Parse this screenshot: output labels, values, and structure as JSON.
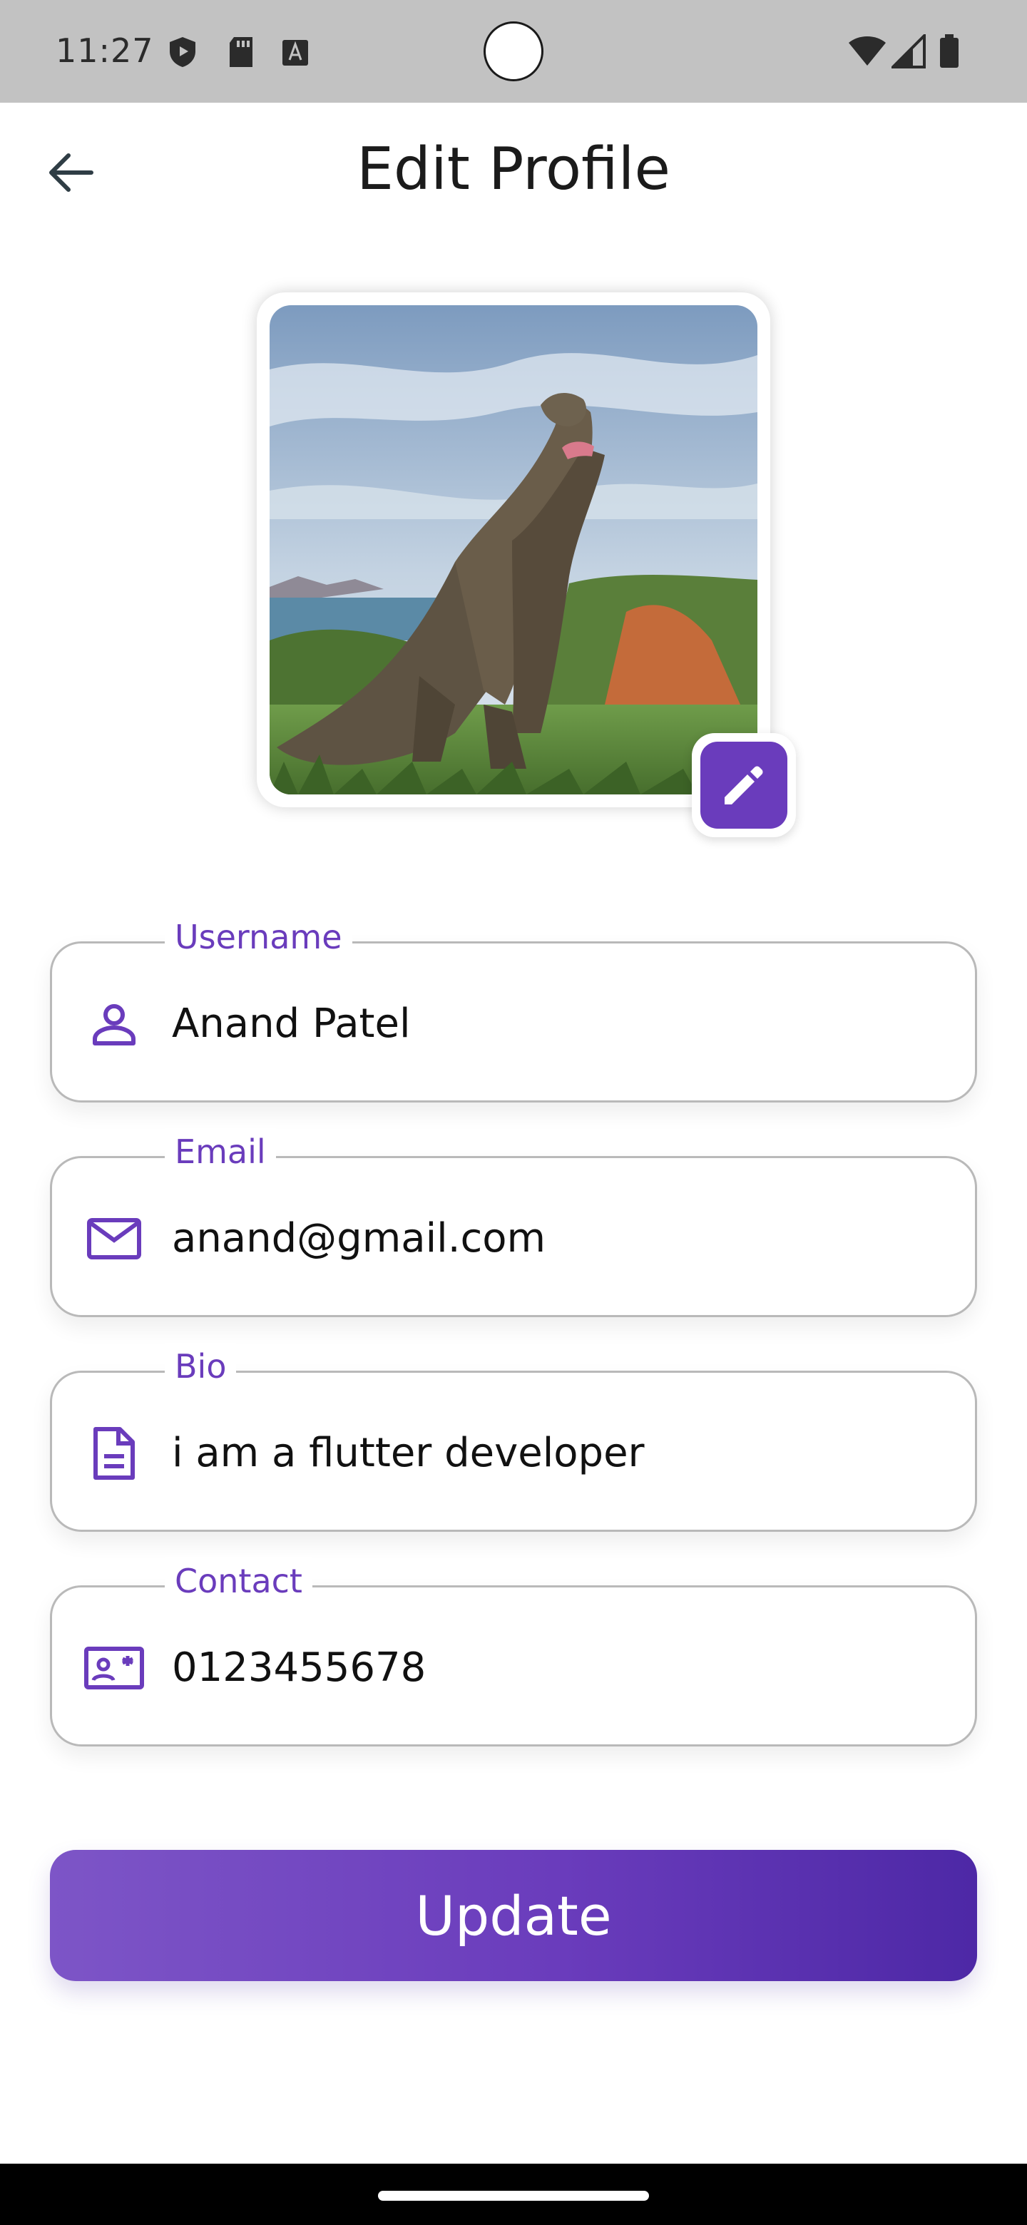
{
  "status_bar": {
    "time": "11:27",
    "left_icons": [
      "shield-icon",
      "sd-card-icon",
      "text-a-icon"
    ],
    "right_icons": [
      "wifi-icon",
      "signal-icon",
      "battery-icon"
    ]
  },
  "app_bar": {
    "title": "Edit Profile",
    "back_icon": "arrow-left-icon"
  },
  "avatar": {
    "edit_icon": "pencil-icon"
  },
  "fields": {
    "username": {
      "label": "Username",
      "value": "Anand Patel",
      "icon": "person-icon"
    },
    "email": {
      "label": "Email",
      "value": "anand@gmail.com",
      "icon": "mail-icon"
    },
    "bio": {
      "label": "Bio",
      "value": "i am a flutter developer",
      "icon": "document-icon"
    },
    "contact": {
      "label": "Contact",
      "value": "0123455678",
      "icon": "contact-card-icon"
    }
  },
  "actions": {
    "update_label": "Update"
  },
  "colors": {
    "accent": "#6a3cbc",
    "status_bar": "#c2c2c2",
    "field_border": "#b9b9b9"
  }
}
